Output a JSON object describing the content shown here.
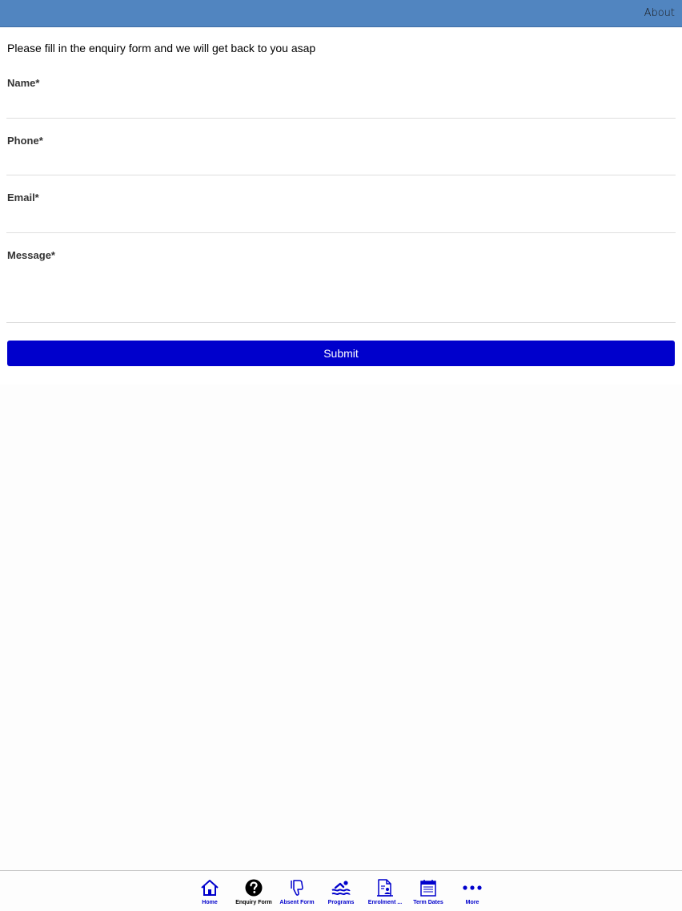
{
  "header": {
    "about_label": "About"
  },
  "form": {
    "intro": "Please fill in the enquiry form and we will get back to you asap",
    "name_label": "Name*",
    "phone_label": "Phone*",
    "email_label": "Email*",
    "message_label": "Message*",
    "name_value": "",
    "phone_value": "",
    "email_value": "",
    "message_value": "",
    "submit_label": "Submit"
  },
  "tabbar": {
    "accent_color": "#0000cc",
    "active_color": "#000000",
    "items": [
      {
        "label": "Home",
        "icon": "home-icon"
      },
      {
        "label": "Enquiry Form",
        "icon": "question-icon",
        "active": true
      },
      {
        "label": "Absent Form",
        "icon": "thumbs-down-icon"
      },
      {
        "label": "Programs",
        "icon": "swimmer-icon"
      },
      {
        "label": "Enrolment ...",
        "icon": "enrolment-document-icon"
      },
      {
        "label": "Term Dates",
        "icon": "calendar-icon"
      },
      {
        "label": "More",
        "icon": "more-icon"
      }
    ]
  }
}
